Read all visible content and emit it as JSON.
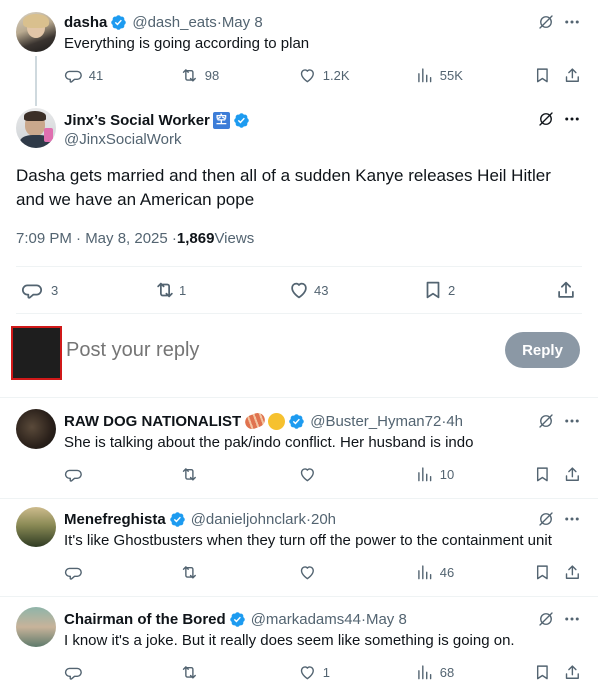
{
  "colors": {
    "accent": "#1d9bf0",
    "muted": "#536471",
    "text": "#0f1419",
    "reply_button_bg": "#8b98a5",
    "divider": "#eff3f4"
  },
  "parent": {
    "name": "dasha",
    "handle": "@dash_eats",
    "date": "May 8",
    "text": "Everything is going according to plan",
    "replies": "41",
    "reposts": "98",
    "likes": "1.2K",
    "views": "55K"
  },
  "main": {
    "name": "Jinx’s Social Worker",
    "name_emoji": "空",
    "handle": "@JinxSocialWork",
    "text_line1": "Dasha gets married and then all of a sudden Kanye releases Heil Hitler",
    "text_line2": "and we have an American pope",
    "time": "7:09 PM · May 8, 2025 · ",
    "views_count": "1,869",
    "views_label": " Views",
    "replies": "3",
    "reposts": "1",
    "likes": "43",
    "bookmarks": "2"
  },
  "composer": {
    "placeholder": "Post your reply",
    "reply_label": "Reply"
  },
  "replies": [
    {
      "name": "RAW DOG NATIONALIST",
      "handle": "@Buster_Hyman72",
      "date": "4h",
      "text": "She is talking about the pak/indo conflict. Her husband is indo",
      "replies": "",
      "reposts": "",
      "likes": "",
      "views": "10"
    },
    {
      "name": "Menefreghista",
      "handle": "@danieljohnclark",
      "date": "20h",
      "text": "It's like Ghostbusters when they turn off the power to the containment unit",
      "replies": "",
      "reposts": "",
      "likes": "",
      "views": "46"
    },
    {
      "name": "Chairman of the Bored",
      "handle": "@markadams44",
      "date": "May 8",
      "text": "I know it's a joke. But it really does seem like something is going on.",
      "replies": "",
      "reposts": "",
      "likes": "1",
      "views": "68"
    }
  ],
  "separator": " · ",
  "icons": [
    "reply-icon",
    "repost-icon",
    "like-icon",
    "views-icon",
    "bookmark-icon",
    "share-icon",
    "grok-icon",
    "more-icon",
    "verified-icon"
  ]
}
